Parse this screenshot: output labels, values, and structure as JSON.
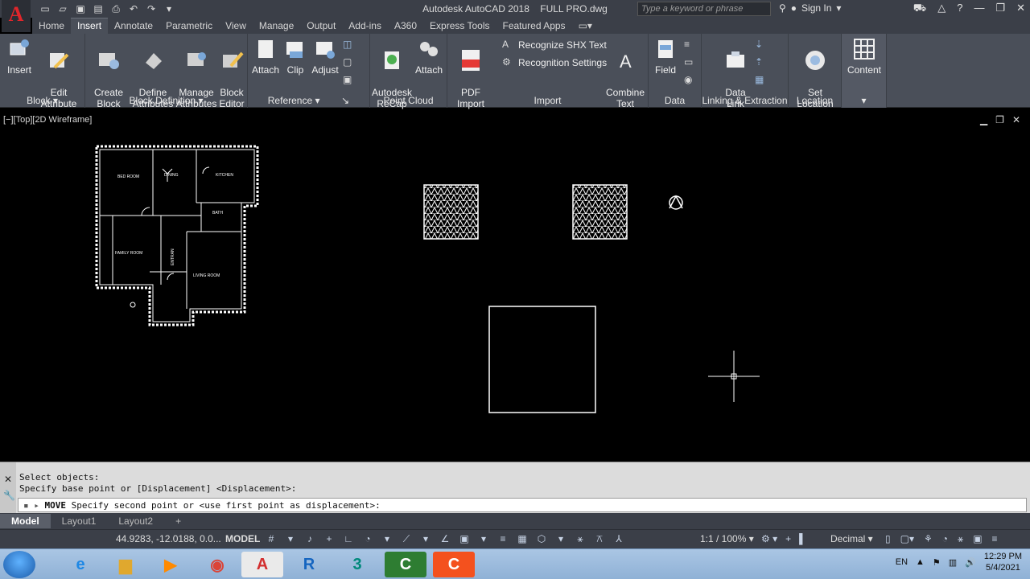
{
  "title_bar": {
    "app_name": "Autodesk AutoCAD 2018",
    "file_name": "FULL PRO.dwg",
    "search_placeholder": "Type a keyword or phrase",
    "sign_in": "Sign In",
    "logo": "A"
  },
  "ribbon_tabs": [
    "Home",
    "Insert",
    "Annotate",
    "Parametric",
    "View",
    "Manage",
    "Output",
    "Add-ins",
    "A360",
    "Express Tools",
    "Featured Apps"
  ],
  "active_tab": "Insert",
  "ribbon": {
    "block": {
      "title": "Block",
      "insert": "Insert",
      "edit_attribute": "Edit\nAttribute"
    },
    "block_definition": {
      "title": "Block Definition",
      "create_block": "Create\nBlock",
      "define_attributes": "Define\nAttributes",
      "manage_attributes": "Manage\nAttributes",
      "block_editor": "Block\nEditor"
    },
    "reference": {
      "title": "Reference",
      "attach": "Attach",
      "clip": "Clip",
      "adjust": "Adjust"
    },
    "point_cloud": {
      "title": "Point Cloud",
      "recap": "Autodesk\nReCap",
      "attach": "Attach"
    },
    "import": {
      "title": "Import",
      "pdf_import": "PDF\nImport",
      "pdf_badge": "PDF",
      "recognize_shx": "Recognize SHX Text",
      "recognition_settings": "Recognition Settings",
      "combine_text": "Combine\nText"
    },
    "data": {
      "title": "Data",
      "field": "Field"
    },
    "linking": {
      "title": "Linking & Extraction",
      "data_link": "Data\nLink"
    },
    "location": {
      "title": "Location",
      "set_location": "Set\nLocation"
    },
    "content": {
      "title": "Content"
    }
  },
  "viewport": {
    "label": "[−][Top][2D Wireframe]",
    "floorplan_rooms": [
      "BED ROOM",
      "DINING",
      "KITCHEN",
      "BATH",
      "FAMILY ROOM",
      "ENTRAN",
      "LIVING ROOM"
    ]
  },
  "command_line": {
    "history": [
      "Select objects:",
      "Specify base point or [Displacement] <Displacement>:"
    ],
    "prompt_cmd": "MOVE",
    "prompt_text": "Specify second point or <use first point as displacement>:"
  },
  "layout_tabs": [
    "Model",
    "Layout1",
    "Layout2"
  ],
  "status_bar": {
    "coordinates": "44.9283, -12.0188, 0.0...",
    "model": "MODEL",
    "scale": "1:1 / 100%",
    "units": "Decimal"
  },
  "taskbar": {
    "language": "EN",
    "time": "12:29 PM",
    "date": "5/4/2021"
  }
}
